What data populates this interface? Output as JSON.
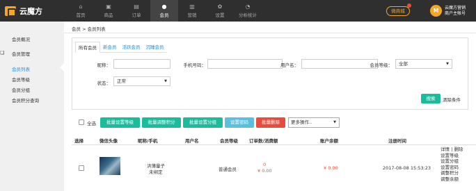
{
  "brand": {
    "name": "云魔方"
  },
  "nav": [
    {
      "label": "首页",
      "icon": "home-icon",
      "glyph": "⌂",
      "active": false
    },
    {
      "label": "商品",
      "icon": "goods-icon",
      "glyph": "▣",
      "active": false
    },
    {
      "label": "订单",
      "icon": "order-icon",
      "glyph": "▤",
      "active": false
    },
    {
      "label": "会员",
      "icon": "member-icon",
      "glyph": "●",
      "active": true
    },
    {
      "label": "营销",
      "icon": "marketing-icon",
      "glyph": "▥",
      "active": false
    },
    {
      "label": "设置",
      "icon": "settings-icon",
      "glyph": "✿",
      "active": false
    },
    {
      "label": "分析统计",
      "icon": "stats-icon",
      "glyph": "◔",
      "active": false
    }
  ],
  "header": {
    "shop_button": "微商城",
    "avatar_letter": "M",
    "user_line1": "云魔方营销",
    "user_line2": "商户主帐号"
  },
  "sidebar": {
    "overview": "会员概况",
    "group": "会员管理",
    "items": [
      "会员列表",
      "会员等级",
      "会员分组",
      "会员积分查询"
    ]
  },
  "breadcrumb": "会员 > 会员列表",
  "tabs": [
    "所有会员",
    "新会员",
    "活跃会员",
    "沉睡会员"
  ],
  "filters": {
    "nickname_label": "昵称：",
    "phone_label": "手机号码：",
    "username_label": "用户名：",
    "level_label": "会员等级：",
    "level_value": "全部",
    "status_label": "状态：",
    "status_value": "正常",
    "search_button": "搜索",
    "clear_link": "清除条件"
  },
  "actions": {
    "select_all": "全选",
    "buttons": [
      "批量设置等级",
      "批量调整积分",
      "批量设置分组",
      "设置密码",
      "批量删除"
    ],
    "more_ops": "更多操作.."
  },
  "table": {
    "headers": [
      "选择",
      "微信头像",
      "昵称/手机",
      "用户名",
      "会员等级",
      "订单数/消费额",
      "账户余额",
      "注册时间"
    ],
    "rows": [
      {
        "nickname": "洪薄量子",
        "phone": "未绑定",
        "username": "",
        "level": "普通会员",
        "order_count": "0",
        "order_amount": "¥ 0.00",
        "balance": "¥ 0.00",
        "register_time": "2017-08-08 15:53:23",
        "ops": [
          "详情 | 删除",
          "设置等级",
          "设置分组",
          "设置密码",
          "调整积分",
          "调整余额"
        ]
      }
    ]
  }
}
